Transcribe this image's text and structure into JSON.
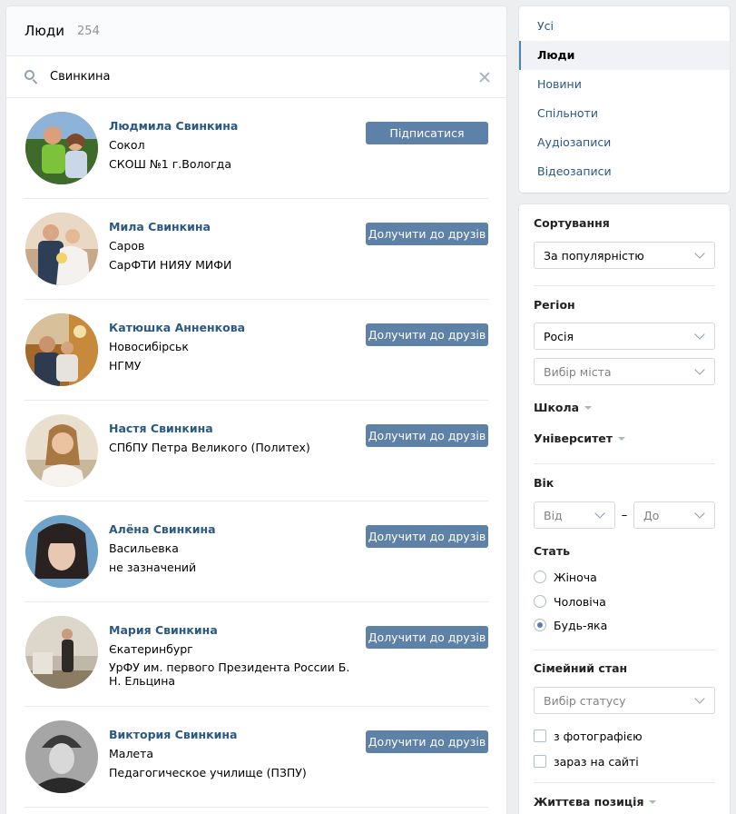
{
  "header": {
    "title": "Люди",
    "count": "254"
  },
  "search": {
    "value": "Свинкина",
    "icon": "search-icon",
    "clear_icon": "close-icon"
  },
  "people": [
    {
      "name": "Людмила Свинкина",
      "line1": "Сокол",
      "line2": "СКОШ №1 г.Вологда",
      "button": "Підписатися"
    },
    {
      "name": "Мила Свинкина",
      "line1": "Саров",
      "line2": "СарФТИ НИЯУ МИФИ",
      "button": "Долучити до друзів"
    },
    {
      "name": "Катюшка Анненкова",
      "line1": "Новосибірськ",
      "line2": "НГМУ",
      "button": "Долучити до друзів"
    },
    {
      "name": "Настя Свинкина",
      "line1": "СПбПУ Петра Великого (Политех)",
      "line2": "",
      "button": "Долучити до друзів"
    },
    {
      "name": "Алёна Свинкина",
      "line1": "Васильевка",
      "line2": "не зазначений",
      "button": "Долучити до друзів"
    },
    {
      "name": "Мария Свинкина",
      "line1": "Єкатеринбург",
      "line2": "УрФУ им. первого Президента России Б. Н. Ельцина",
      "button": "Долучити до друзів"
    },
    {
      "name": "Виктория Свинкина",
      "line1": "Малета",
      "line2": "Педагогическое училище (ПЗПУ)",
      "button": "Долучити до друзів"
    }
  ],
  "menu": {
    "items": [
      {
        "label": "Усі",
        "active": false
      },
      {
        "label": "Люди",
        "active": true
      },
      {
        "label": "Новини",
        "active": false
      },
      {
        "label": "Спільноти",
        "active": false
      },
      {
        "label": "Аудіозаписи",
        "active": false
      },
      {
        "label": "Відеозаписи",
        "active": false
      }
    ]
  },
  "filters": {
    "sort": {
      "title": "Сортування",
      "value": "За популярністю"
    },
    "region": {
      "title": "Регіон",
      "country": "Росія",
      "city_placeholder": "Вибір міста"
    },
    "school": "Школа",
    "university": "Університет",
    "age": {
      "title": "Вік",
      "from": "Від",
      "dash": "–",
      "to": "До"
    },
    "sex": {
      "title": "Стать",
      "options": [
        {
          "label": "Жіноча",
          "checked": false
        },
        {
          "label": "Чоловіча",
          "checked": false
        },
        {
          "label": "Будь-яка",
          "checked": true
        }
      ]
    },
    "marital": {
      "title": "Сімейний стан",
      "placeholder": "Вибір статусу"
    },
    "with_photo": "з фотографією",
    "online": "зараз на сайті",
    "life_position": "Життєва позиція"
  },
  "colors": {
    "link": "#2a5885",
    "button": "#5e81a8",
    "active_bar": "#5181b8",
    "background": "#edeef0"
  }
}
